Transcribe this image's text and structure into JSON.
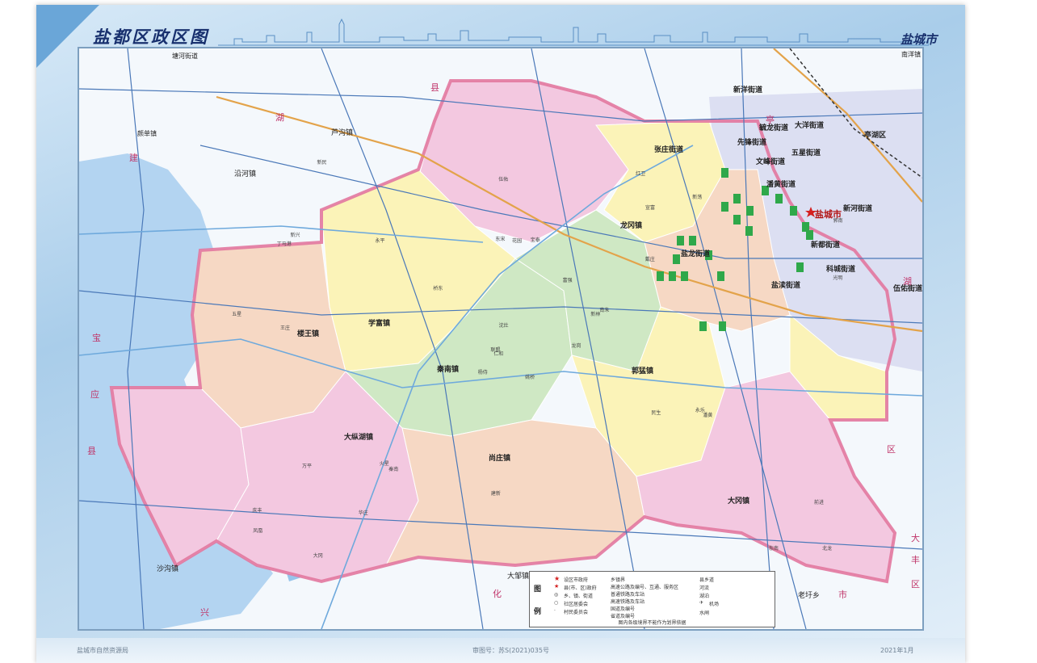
{
  "header": {
    "title": "盐都区政区图",
    "city": "盐城市"
  },
  "footer": {
    "left": "盐城市自然资源局",
    "center": "审图号：苏S(2021)035号",
    "right": "2021年1月"
  },
  "legend": {
    "heading": [
      "图",
      "例"
    ],
    "items": [
      "设区市政府",
      "县(市、区)政府",
      "乡、镇、街道",
      "社区居委会",
      "村民委员会",
      "乡镇界",
      "高速公路及编号、互通、服务区",
      "普通铁路及车站",
      "高速铁路及车站",
      "国道及编号",
      "省道及编号",
      "县乡道",
      "河流",
      "湖泊",
      "机场",
      "水闸"
    ],
    "note": "图内各级境界不能作为划界依据"
  },
  "map": {
    "towns": [
      {
        "id": "louwang",
        "name": "楼王镇"
      },
      {
        "id": "xuefu",
        "name": "学富镇"
      },
      {
        "id": "qinnan",
        "name": "秦南镇"
      },
      {
        "id": "guomeng",
        "name": "郭猛镇"
      },
      {
        "id": "dazonghu",
        "name": "大纵湖镇"
      },
      {
        "id": "shangzhuang",
        "name": "尚庄镇"
      },
      {
        "id": "dagang",
        "name": "大冈镇"
      },
      {
        "id": "longgang",
        "name": "龙冈镇"
      },
      {
        "id": "yanlong",
        "name": "盐龙街道"
      },
      {
        "id": "yandu",
        "name": "盐渎街道"
      },
      {
        "id": "zhangzhuang",
        "name": "张庄街道"
      },
      {
        "id": "pannhuang",
        "name": "潘黄街道"
      },
      {
        "id": "xindu",
        "name": "新都街道"
      },
      {
        "id": "kecheng",
        "name": "科城街道"
      },
      {
        "id": "wenfeng",
        "name": "文峰街道"
      },
      {
        "id": "xinxian",
        "name": "先锋街道"
      },
      {
        "id": "yulong",
        "name": "毓龙街道"
      },
      {
        "id": "dayang",
        "name": "大洋街道"
      },
      {
        "id": "wuxing",
        "name": "五星街道"
      },
      {
        "id": "xinhe",
        "name": "新河街道"
      },
      {
        "id": "xinyang",
        "name": "新洋街道"
      },
      {
        "id": "wuyou",
        "name": "伍佑街道"
      },
      {
        "id": "luhe",
        "name": "芦沟镇"
      },
      {
        "id": "yanhe",
        "name": "沿河镇"
      },
      {
        "id": "shagou",
        "name": "沙沟镇"
      },
      {
        "id": "dazou",
        "name": "大邹镇"
      },
      {
        "id": "laoyu",
        "name": "老圩乡"
      },
      {
        "id": "tanghe",
        "name": "塘河街道"
      },
      {
        "id": "nanyang",
        "name": "南洋镇"
      },
      {
        "id": "jiudan",
        "name": "颜单镇"
      }
    ],
    "city_label": "盐城市",
    "district_label": "亭湖区",
    "region_chars": [
      "县",
      "湖",
      "建",
      "宝",
      "应",
      "县",
      "兴",
      "化",
      "市",
      "大",
      "丰",
      "区",
      "亭",
      "湖",
      "区"
    ],
    "villages": [
      "姚桥",
      "丁马港",
      "仁和",
      "庆丰",
      "新林",
      "秦南",
      "红卫",
      "宝泰",
      "宣富",
      "龙岗",
      "新民",
      "北龙",
      "王庄",
      "郭南",
      "杨侍",
      "戴庄",
      "大冈",
      "东宋",
      "富强",
      "万平",
      "桥东",
      "凤凰",
      "华庄",
      "花园",
      "南朱",
      "潘黄",
      "新兴",
      "伍佑",
      "五星",
      "民生",
      "光明",
      "联盟",
      "建新",
      "沈灶",
      "永平",
      "新荡",
      "火星",
      "东南",
      "前进",
      "永乐"
    ]
  },
  "colors": {
    "pink": "#f3c8e0",
    "yellow": "#fbf3b8",
    "green": "#cfe8c4",
    "lavender": "#dcd8f0",
    "peach": "#f6d8c4",
    "water": "#9dc8ee",
    "road": "#4a78b8",
    "boundary": "#e2779f",
    "urban": "#d7d9f0"
  }
}
